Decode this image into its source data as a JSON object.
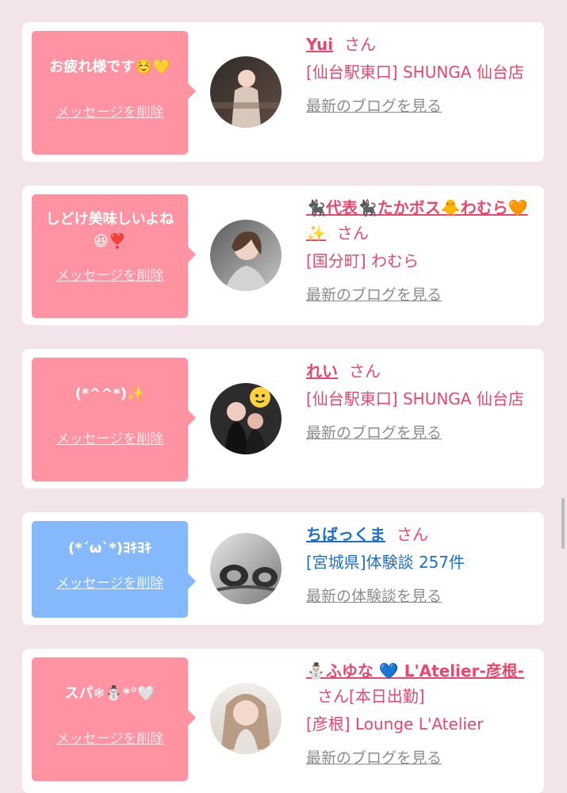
{
  "cards": [
    {
      "message": "お疲れ様です☺️💛",
      "delete_label": "メッセージを削除",
      "name": "Yui",
      "honorific": "さん",
      "shop": "[仙台駅東口] SHUNGA 仙台店",
      "blog_label": "最新のブログを見る",
      "bubble_color": "#ff93a1"
    },
    {
      "message": "しどけ美味しいよね😆❣️",
      "delete_label": "メッセージを削除",
      "name": "🐈‍⬛代表🐈‍⬛たかボス🐥わむら🧡✨",
      "honorific": "さん",
      "shop": "[国分町] わむら",
      "blog_label": "最新のブログを見る",
      "bubble_color": "#ff93a1"
    },
    {
      "message": "(*^^*)✨",
      "delete_label": "メッセージを削除",
      "name": "れい",
      "honorific": "さん",
      "shop": "[仙台駅東口] SHUNGA 仙台店",
      "blog_label": "最新のブログを見る",
      "bubble_color": "#ff93a1"
    },
    {
      "message": "(*´ω`*)ﾖｷﾖｷ",
      "delete_label": "メッセージを削除",
      "name": "ちばっくま",
      "honorific": "さん",
      "shop": "[宮城県]体験談 257件",
      "blog_label": "最新の体験談を見る",
      "bubble_color": "#86b9fb"
    },
    {
      "message": "スパ❄⛄*°🤍",
      "delete_label": "メッセージを削除",
      "name": "⛄ふゆな 💙 L'Atelier-彦根-",
      "honorific": "さん",
      "status": "[本日出勤]",
      "shop": "[彦根] Lounge L'Atelier",
      "blog_label": "最新のブログを見る",
      "bubble_color": "#ff93a1"
    }
  ]
}
